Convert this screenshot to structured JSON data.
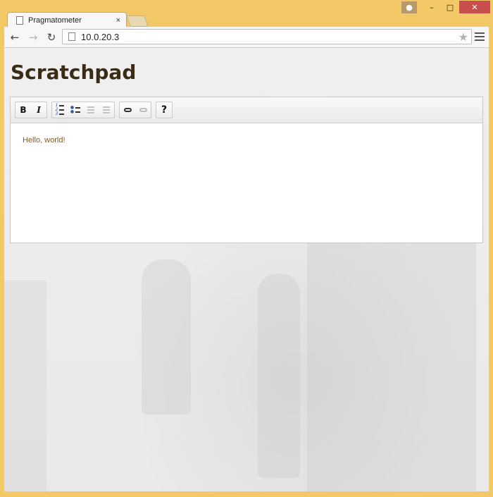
{
  "browser": {
    "tab_title": "Pragmatometer",
    "tab_close": "×",
    "url": "10.0.20.3"
  },
  "page": {
    "heading": "Scratchpad",
    "editor_text": "Hello, world!"
  },
  "editor_toolbar": {
    "bold_label": "B",
    "italic_label": "I",
    "help_label": "?"
  },
  "colors": {
    "frame": "#f3c967",
    "heading": "#3b2a14",
    "editor_text": "#7a5a2a"
  }
}
